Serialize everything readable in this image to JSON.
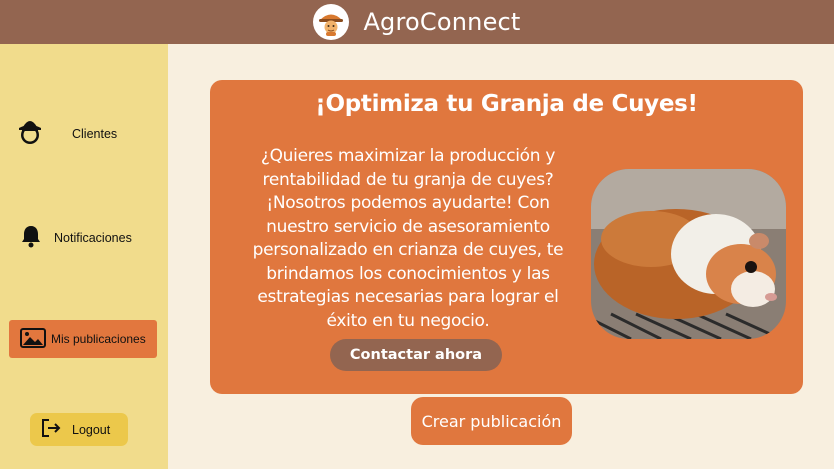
{
  "app": {
    "title": "AgroConnect"
  },
  "sidebar": {
    "items": [
      {
        "label": "Clientes",
        "icon": "farmer-hat-icon"
      },
      {
        "label": "Notificaciones",
        "icon": "bell-icon"
      },
      {
        "label": "Mis publicaciones",
        "icon": "image-icon",
        "active": true
      }
    ],
    "logout_label": "Logout"
  },
  "promo": {
    "title": "¡Optimiza tu Granja de Cuyes!",
    "lines": [
      "¿Quieres maximizar la producción y",
      "rentabilidad de tu granja de cuyes?",
      "¡Nosotros podemos ayudarte! Con",
      "nuestro servicio de asesoramiento",
      "personalizado en crianza de cuyes, te",
      "brindamos los conocimientos y las",
      "estrategias necesarias para lograr el",
      "éxito en tu negocio."
    ],
    "cta_label": "Contactar ahora",
    "image_icon": "guinea-pig-photo"
  },
  "main": {
    "create_label": "Crear publicación"
  },
  "colors": {
    "topbar": "#936550",
    "sidebar": "#f1dc8c",
    "accent": "#e0773e",
    "background": "#f8efdf",
    "logout": "#ecc84b"
  }
}
